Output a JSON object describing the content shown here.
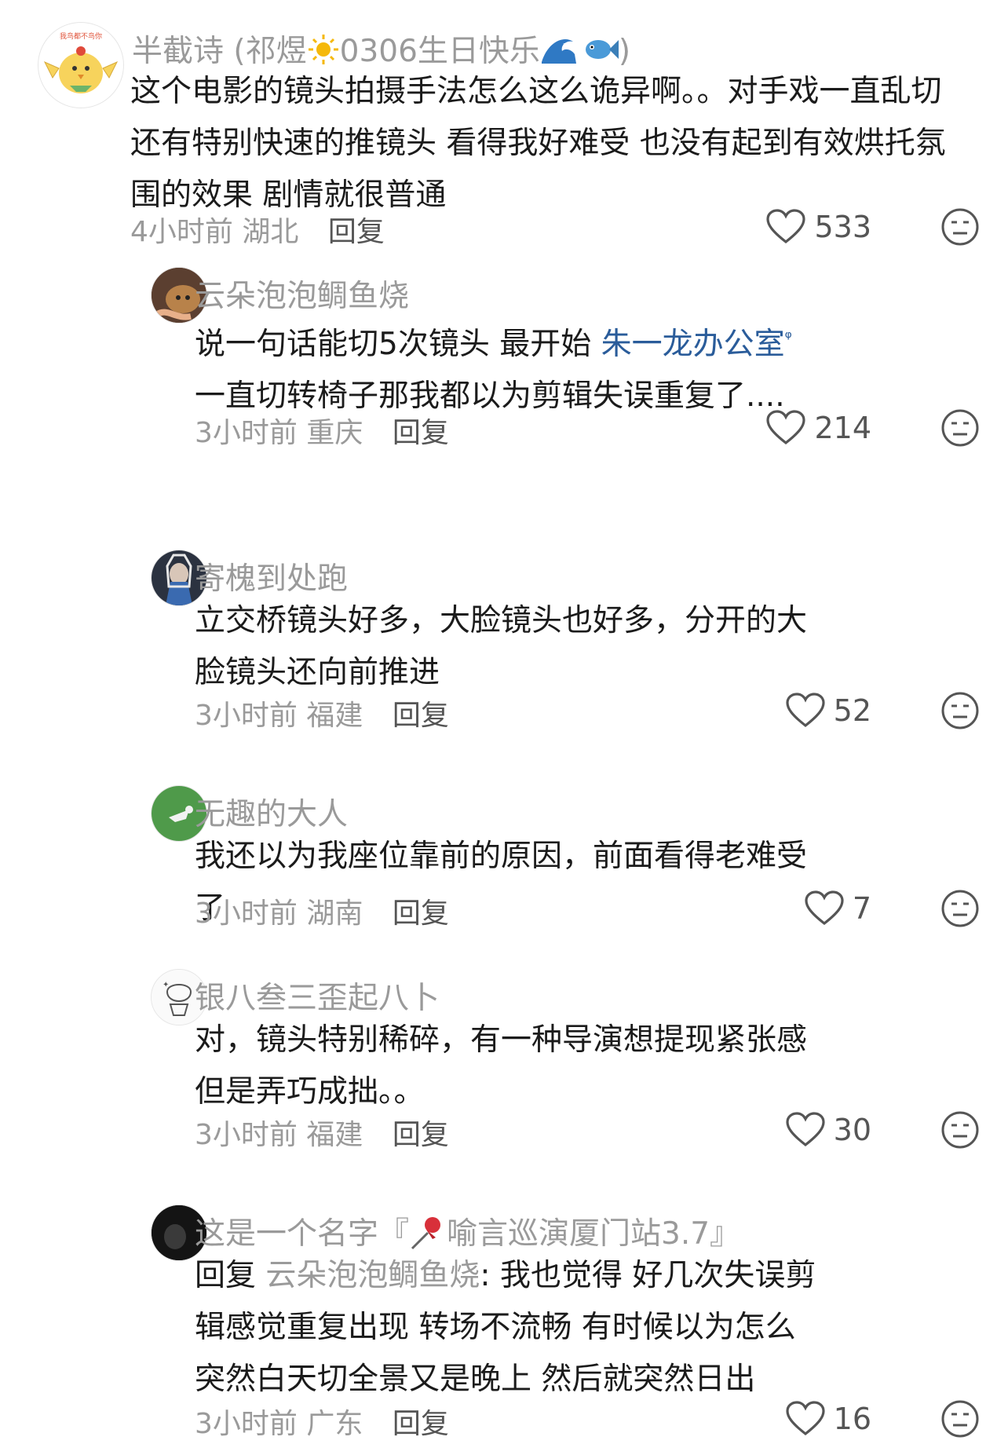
{
  "comments": [
    {
      "name": "半截诗 (祁煜",
      "name_suffix": "0306生日快乐",
      "name_close": ")",
      "text": "这个电影的镜头拍摄手法怎么这么诡异啊。。对手戏一直乱切 还有特别快速的推镜头 看得我好难受 也没有起到有效烘托氛围的效果 剧情就很普通",
      "time": "4小时前",
      "region": "湖北",
      "reply": "回复",
      "likes": "533",
      "avatar_text": "我鸟都不鸟你"
    },
    {
      "name": "云朵泡泡鲷鱼烧",
      "text_before": "说一句话能切5次镜头 最开始 ",
      "link": "朱一龙办公室",
      "text_after": " 一直切转椅子那我都以为剪辑失误重复了....",
      "time": "3小时前",
      "region": "重庆",
      "reply": "回复",
      "likes": "214"
    },
    {
      "name": "寄槐到处跑",
      "text": "立交桥镜头好多，大脸镜头也好多，分开的大脸镜头还向前推进",
      "time": "3小时前",
      "region": "福建",
      "reply": "回复",
      "likes": "52"
    },
    {
      "name": "无趣的大人",
      "text": "我还以为我座位靠前的原因，前面看得老难受了",
      "time": "3小时前",
      "region": "湖南",
      "reply": "回复",
      "likes": "7"
    },
    {
      "name": "银八叁三歪起八卜",
      "text": "对，镜头特别稀碎，有一种导演想提现紧张感但是弄巧成拙。。",
      "time": "3小时前",
      "region": "福建",
      "reply": "回复",
      "likes": "30"
    },
    {
      "name": "这是一个名字『",
      "name_suffix": "喻言巡演厦门站3.7』",
      "reply_prefix": "回复 ",
      "reply_to": "云朵泡泡鲷鱼烧",
      "text": ": 我也觉得 好几次失误剪辑感觉重复出现 转场不流畅 有时候以为怎么突然白天切全景又是晚上 然后就突然日出",
      "time": "3小时前",
      "region": "广东",
      "reply": "回复",
      "likes": "16"
    }
  ],
  "colors": {
    "muted": "#9a9a9a",
    "link": "#2a5c9a",
    "text": "#1b1b1b"
  },
  "icons": [
    "heart-outline-icon",
    "meh-face-icon",
    "sun-emoji",
    "wave-emoji",
    "fish-emoji",
    "pushpin-emoji",
    "search-icon"
  ]
}
